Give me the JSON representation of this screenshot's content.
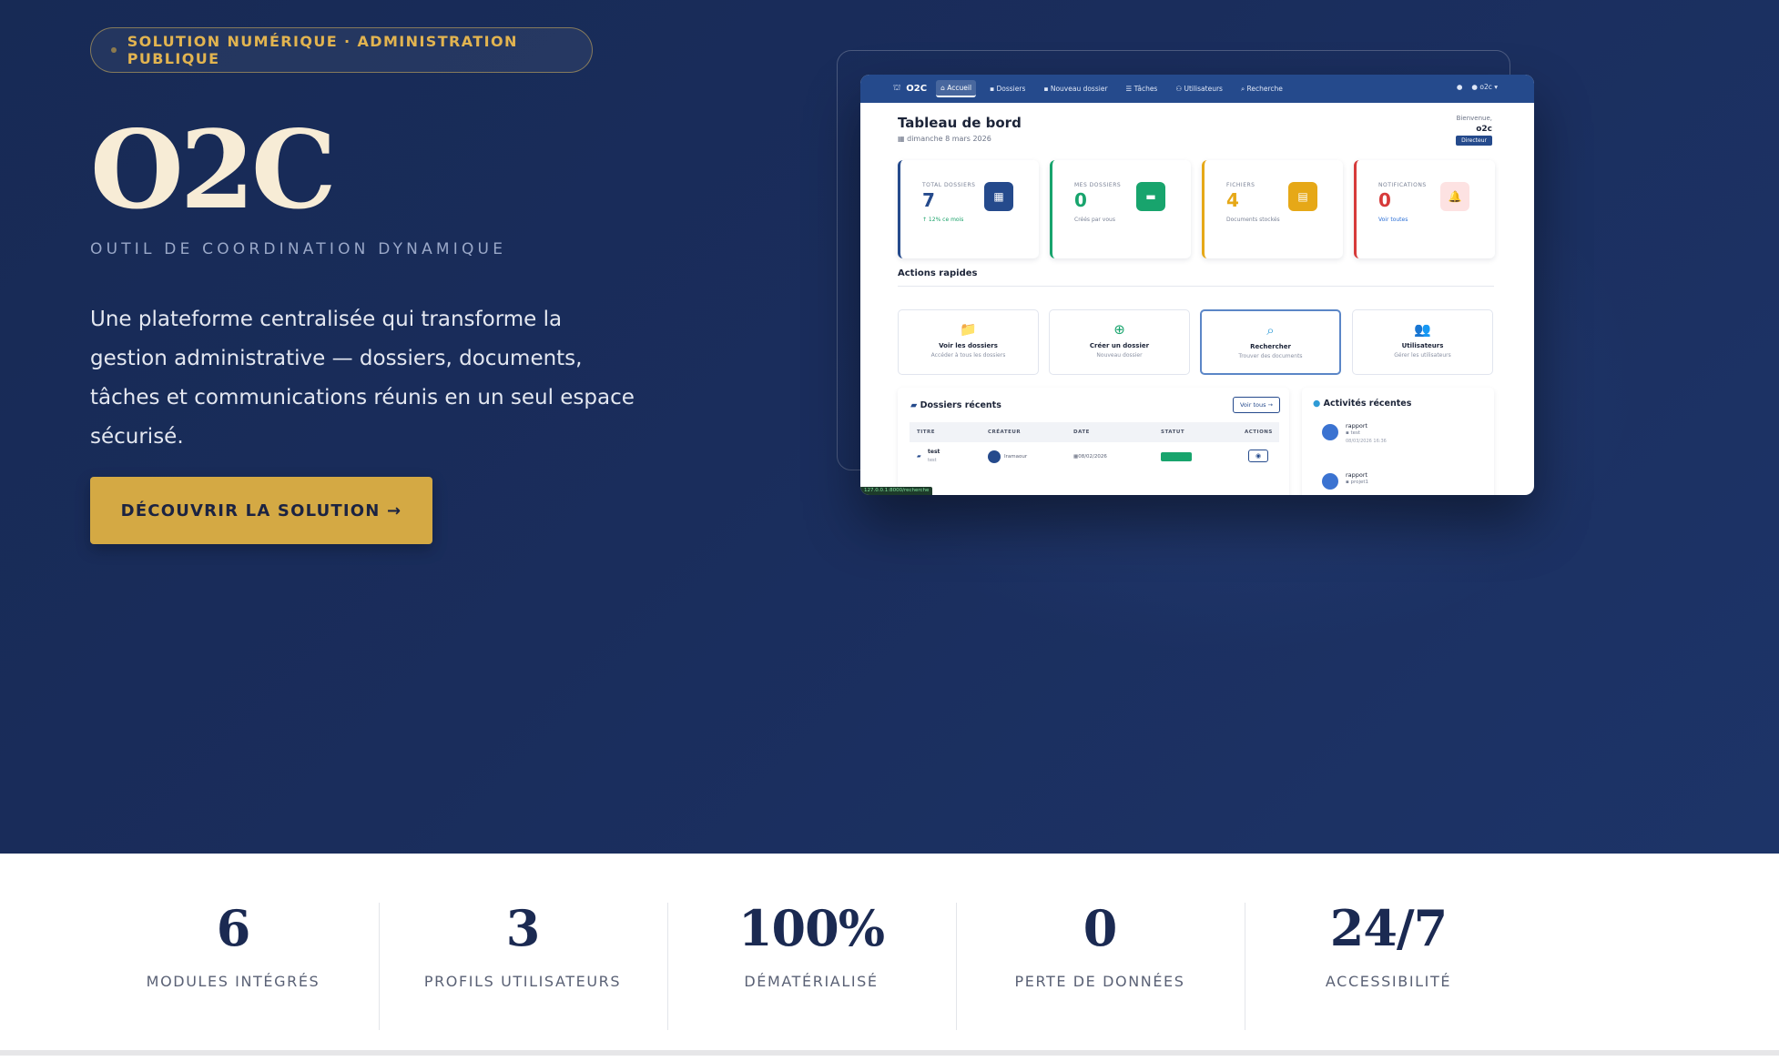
{
  "hero": {
    "badge": "SOLUTION NUMÉRIQUE · ADMINISTRATION PUBLIQUE",
    "logo": "O2C",
    "tagline": "OUTIL DE COORDINATION DYNAMIQUE",
    "description": "Une plateforme centralisée qui transforme la gestion administrative — dossiers, documents, tâches et communications réunis en un seul espace sécurisé.",
    "cta": "DÉCOUVRIR LA SOLUTION →"
  },
  "mock": {
    "brand": "O2C",
    "nav": [
      "Accueil",
      "Dossiers",
      "Nouveau dossier",
      "Tâches",
      "Utilisateurs",
      "Recherche"
    ],
    "user_menu": "o2c",
    "title": "Tableau de bord",
    "date": "dimanche 8 mars 2026",
    "welcome": "Bienvenue,",
    "username": "o2c",
    "role": "Directeur",
    "stats": [
      {
        "label": "TOTAL DOSSIERS",
        "value": "7",
        "sub": "↑ 12% ce mois",
        "color": "#254a8c",
        "icon_color": "#254a8c",
        "sub_color": "#1ba26a"
      },
      {
        "label": "MES DOSSIERS",
        "value": "0",
        "sub": "Créés par vous",
        "color": "#18a46d",
        "icon_color": "#18a46d",
        "sub_color": "#7a8296"
      },
      {
        "label": "FICHIERS",
        "value": "4",
        "sub": "Documents stockés",
        "color": "#e6a817",
        "icon_color": "#e6a817",
        "sub_color": "#7a8296"
      },
      {
        "label": "NOTIFICATIONS",
        "value": "0",
        "sub": "Voir toutes",
        "color": "#d63a3a",
        "icon_color": "#fde2e2",
        "sub_color": "#2b6fd6"
      }
    ],
    "quick_actions_title": "Actions rapides",
    "actions": [
      {
        "title": "Voir les dossiers",
        "sub": "Accéder à tous les dossiers",
        "icon": "📁",
        "icon_color": "#254a8c"
      },
      {
        "title": "Créer un dossier",
        "sub": "Nouveau dossier",
        "icon": "⊕",
        "icon_color": "#18a46d"
      },
      {
        "title": "Rechercher",
        "sub": "Trouver des documents",
        "icon": "⌕",
        "icon_color": "#2f9bd6"
      },
      {
        "title": "Utilisateurs",
        "sub": "Gérer les utilisateurs",
        "icon": "👥",
        "icon_color": "#5a6175"
      }
    ],
    "recent": {
      "title": "Dossiers récents",
      "voir_tous": "Voir tous →",
      "columns": [
        "TITRE",
        "CRÉATEUR",
        "DATE",
        "STATUT",
        "ACTIONS"
      ],
      "rows": [
        {
          "titre": "test",
          "sub": "test",
          "createur": "Iramaour",
          "date": "08/02/2026",
          "statut": "En cours"
        }
      ]
    },
    "activity": {
      "title": "Activités récentes",
      "items": [
        {
          "name": "rapport",
          "folder": "test",
          "time": "08/03/2026 16:36"
        },
        {
          "name": "rapport",
          "folder": "projet1",
          "time": ""
        }
      ]
    },
    "debug": "127.0.0.1:8000/recherche"
  },
  "stats": [
    {
      "value": "6",
      "label": "MODULES INTÉGRÉS"
    },
    {
      "value": "3",
      "label": "PROFILS UTILISATEURS"
    },
    {
      "value": "100%",
      "label": "DÉMATÉRIALISÉ"
    },
    {
      "value": "0",
      "label": "PERTE DE DONNÉES"
    },
    {
      "value": "24/7",
      "label": "ACCESSIBILITÉ"
    }
  ]
}
